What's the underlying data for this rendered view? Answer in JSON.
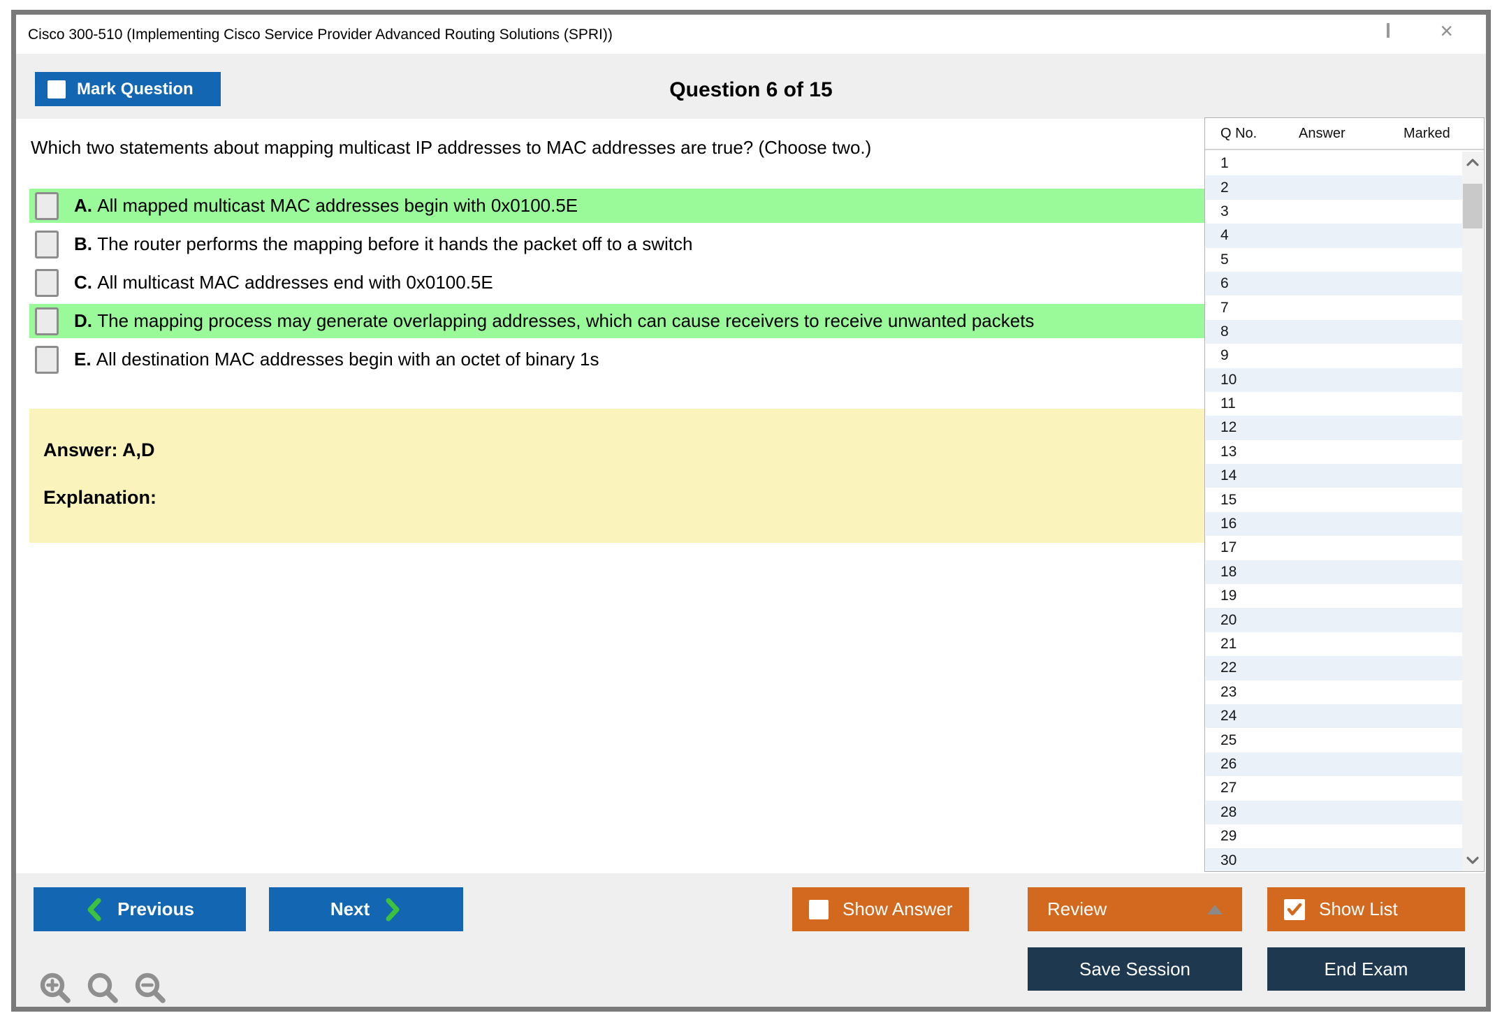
{
  "window": {
    "title": "Cisco 300-510 (Implementing Cisco Service Provider Advanced Routing Solutions (SPRI))",
    "controls": {
      "close_glyph": "×"
    }
  },
  "header": {
    "mark_question_label": "Mark Question",
    "question_counter": "Question 6 of 15"
  },
  "question": {
    "text": "Which two statements about mapping multicast IP addresses to MAC addresses are true? (Choose two.)",
    "options": [
      {
        "letter": "A.",
        "text": "All mapped multicast MAC addresses begin with 0x0100.5E",
        "highlighted": true
      },
      {
        "letter": "B.",
        "text": "The router performs the mapping before it hands the packet off to a switch",
        "highlighted": false
      },
      {
        "letter": "C.",
        "text": "All multicast MAC addresses end with 0x0100.5E",
        "highlighted": false
      },
      {
        "letter": "D.",
        "text": "The mapping process may generate overlapping addresses, which can cause receivers to receive unwanted packets",
        "highlighted": true
      },
      {
        "letter": "E.",
        "text": "All destination MAC addresses begin with an octet of binary 1s",
        "highlighted": false
      }
    ],
    "answer_label": "Answer: A,D",
    "explanation_label": "Explanation:"
  },
  "sidebar": {
    "columns": {
      "q_no": "Q No.",
      "answer": "Answer",
      "marked": "Marked"
    },
    "rows": [
      {
        "q_no": "1",
        "answer": "",
        "marked": ""
      },
      {
        "q_no": "2",
        "answer": "",
        "marked": ""
      },
      {
        "q_no": "3",
        "answer": "",
        "marked": ""
      },
      {
        "q_no": "4",
        "answer": "",
        "marked": ""
      },
      {
        "q_no": "5",
        "answer": "",
        "marked": ""
      },
      {
        "q_no": "6",
        "answer": "",
        "marked": ""
      },
      {
        "q_no": "7",
        "answer": "",
        "marked": ""
      },
      {
        "q_no": "8",
        "answer": "",
        "marked": ""
      },
      {
        "q_no": "9",
        "answer": "",
        "marked": ""
      },
      {
        "q_no": "10",
        "answer": "",
        "marked": ""
      },
      {
        "q_no": "11",
        "answer": "",
        "marked": ""
      },
      {
        "q_no": "12",
        "answer": "",
        "marked": ""
      },
      {
        "q_no": "13",
        "answer": "",
        "marked": ""
      },
      {
        "q_no": "14",
        "answer": "",
        "marked": ""
      },
      {
        "q_no": "15",
        "answer": "",
        "marked": ""
      },
      {
        "q_no": "16",
        "answer": "",
        "marked": ""
      },
      {
        "q_no": "17",
        "answer": "",
        "marked": ""
      },
      {
        "q_no": "18",
        "answer": "",
        "marked": ""
      },
      {
        "q_no": "19",
        "answer": "",
        "marked": ""
      },
      {
        "q_no": "20",
        "answer": "",
        "marked": ""
      },
      {
        "q_no": "21",
        "answer": "",
        "marked": ""
      },
      {
        "q_no": "22",
        "answer": "",
        "marked": ""
      },
      {
        "q_no": "23",
        "answer": "",
        "marked": ""
      },
      {
        "q_no": "24",
        "answer": "",
        "marked": ""
      },
      {
        "q_no": "25",
        "answer": "",
        "marked": ""
      },
      {
        "q_no": "26",
        "answer": "",
        "marked": ""
      },
      {
        "q_no": "27",
        "answer": "",
        "marked": ""
      },
      {
        "q_no": "28",
        "answer": "",
        "marked": ""
      },
      {
        "q_no": "29",
        "answer": "",
        "marked": ""
      },
      {
        "q_no": "30",
        "answer": "",
        "marked": ""
      }
    ]
  },
  "footer": {
    "previous_label": "Previous",
    "next_label": "Next",
    "show_answer_label": "Show Answer",
    "review_label": "Review",
    "show_list_label": "Show List",
    "save_session_label": "Save Session",
    "end_exam_label": "End Exam"
  },
  "icons": {
    "mark_question_checkbox": "empty-white-square",
    "show_answer_checkbox": "empty-white-square",
    "show_list_checkbox": "white-square-orange-check",
    "previous_chevron": "green-chevron-left",
    "next_chevron": "green-chevron-right",
    "review_caret": "gray-triangle-up",
    "zoom_in": "magnifier-plus",
    "zoom_reset": "magnifier",
    "zoom_out": "magnifier-minus",
    "scroll_up": "gray-chevron-up",
    "scroll_down": "gray-chevron-down",
    "minimize": "gray-bar",
    "maximize": "gray-square-outline",
    "close": "gray-x"
  },
  "colors": {
    "accent_blue": "#1366b1",
    "button_orange": "#d2691e",
    "button_navy": "#1d384f",
    "highlight_green": "#9afa9a",
    "answer_yellow": "#faf3bb",
    "chevron_green": "#3dc23d",
    "row_alt_blue": "#eaf1f8"
  }
}
